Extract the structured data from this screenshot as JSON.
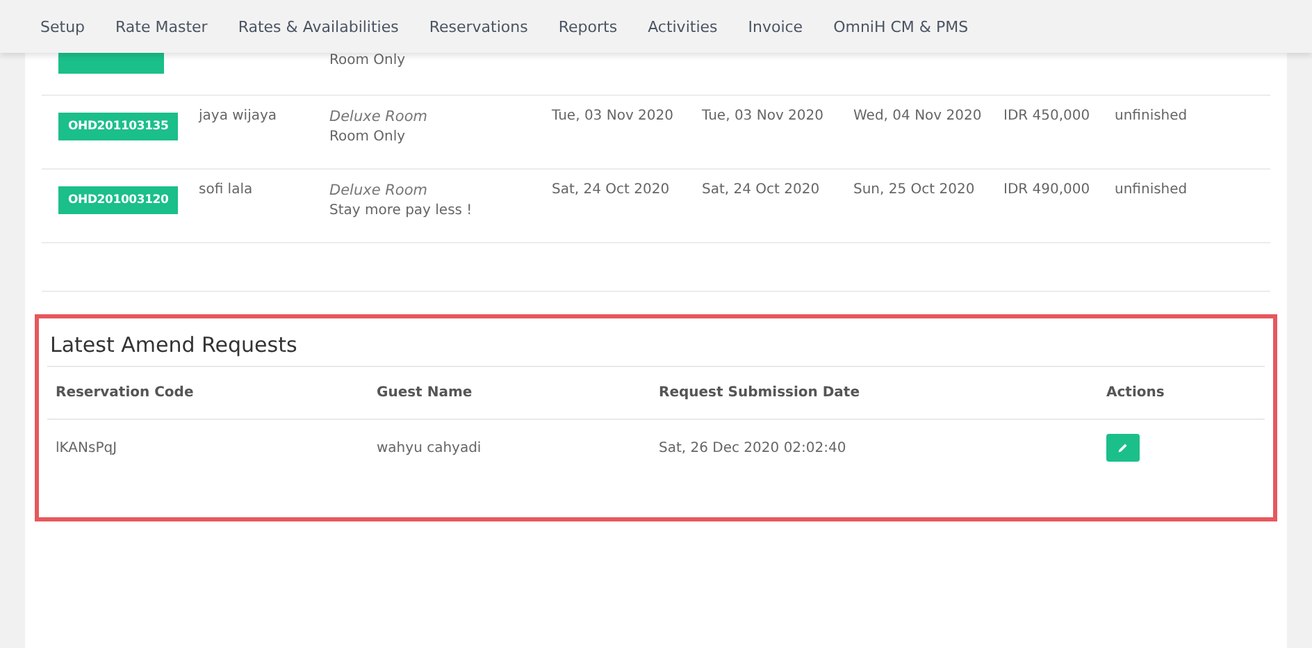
{
  "nav": [
    {
      "label": "Setup"
    },
    {
      "label": "Rate Master"
    },
    {
      "label": "Rates & Availabilities"
    },
    {
      "label": "Reservations"
    },
    {
      "label": "Reports"
    },
    {
      "label": "Activities"
    },
    {
      "label": "Invoice"
    },
    {
      "label": "OmniH CM & PMS"
    }
  ],
  "reservations": [
    {
      "kind": "partial",
      "plan": "Room Only"
    },
    {
      "kind": "full",
      "code": "OHD201103135",
      "guest": "jaya wijaya",
      "room": "Deluxe Room",
      "plan": "Room Only",
      "check_date": "Tue, 03 Nov 2020",
      "arrival": "Tue, 03 Nov 2020",
      "departure": "Wed, 04 Nov 2020",
      "price": "IDR 450,000",
      "status": "unfinished"
    },
    {
      "kind": "full",
      "code": "OHD201003120",
      "guest": "sofi lala",
      "room": "Deluxe Room",
      "plan": "Stay more pay less !",
      "check_date": "Sat, 24 Oct 2020",
      "arrival": "Sat, 24 Oct 2020",
      "departure": "Sun, 25 Oct 2020",
      "price": "IDR 490,000",
      "status": "unfinished"
    }
  ],
  "amend": {
    "title": "Latest Amend Requests",
    "highlighted": true,
    "columns": [
      "Reservation Code",
      "Guest Name",
      "Request Submission Date",
      "Actions"
    ],
    "rows": [
      {
        "code": "lKANsPqJ",
        "guest": "wahyu cahyadi",
        "date": "Sat, 26 Dec 2020 02:02:40"
      }
    ]
  }
}
